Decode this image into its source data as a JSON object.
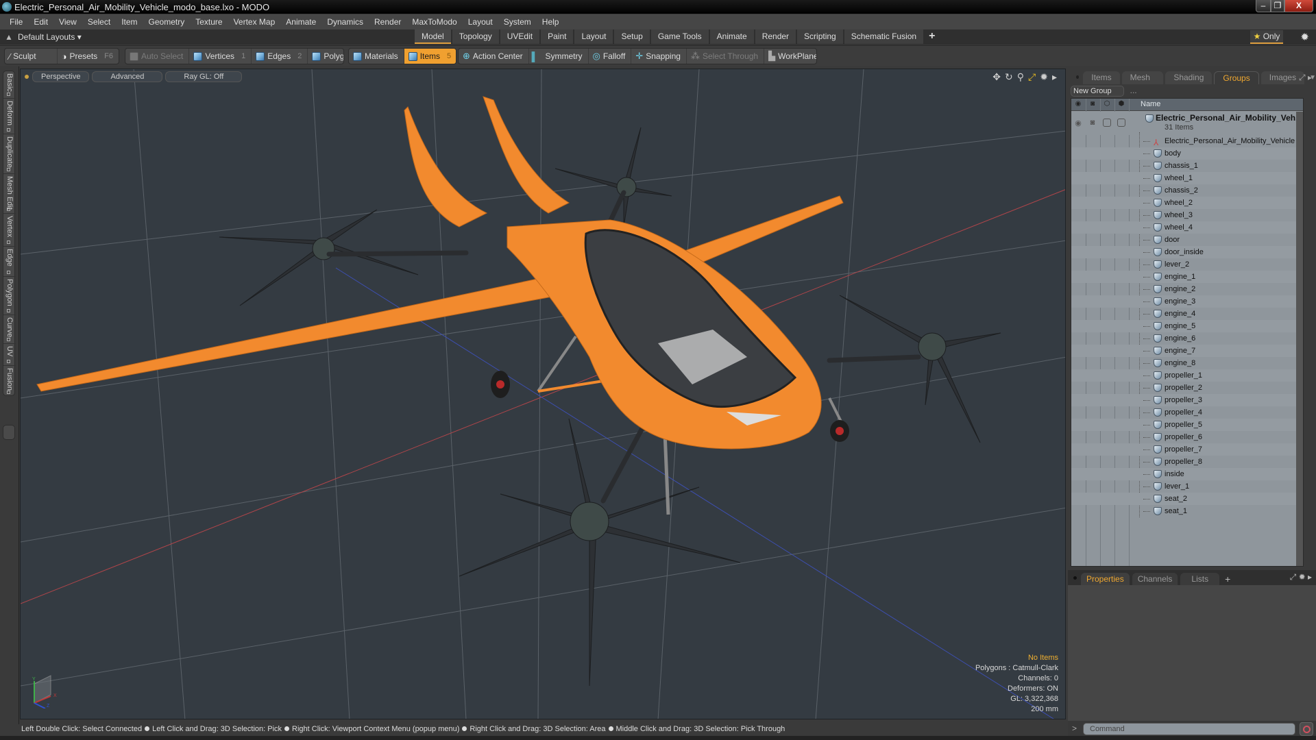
{
  "window": {
    "title": "Electric_Personal_Air_Mobility_Vehicle_modo_base.lxo - MODO",
    "app_icon": "modo-logo-icon",
    "controls": [
      "minimize",
      "restore",
      "close"
    ]
  },
  "menubar": [
    "File",
    "Edit",
    "View",
    "Select",
    "Item",
    "Geometry",
    "Texture",
    "Vertex Map",
    "Animate",
    "Dynamics",
    "Render",
    "MaxToModo",
    "Layout",
    "System",
    "Help"
  ],
  "layoutbar": {
    "layouts_label": "Default Layouts",
    "tabs": [
      "Model",
      "Topology",
      "UVEdit",
      "Paint",
      "Layout",
      "Setup",
      "Game Tools",
      "Animate",
      "Render",
      "Scripting",
      "Schematic Fusion"
    ],
    "active_tab": "Model",
    "only_label": "Only"
  },
  "toolbar": {
    "sculpt": "Sculpt",
    "presets": "Presets",
    "presets_key": "F6",
    "auto_select": "Auto Select",
    "vertices": "Vertices",
    "vertices_key": "1",
    "edges": "Edges",
    "edges_key": "2",
    "polygons": "Polygons",
    "materials": "Materials",
    "items": "Items",
    "items_key": "5",
    "action_center": "Action Center",
    "symmetry": "Symmetry",
    "falloff": "Falloff",
    "snapping": "Snapping",
    "select_through": "Select Through",
    "workplane": "WorkPlane"
  },
  "left_tabs": [
    "Basic",
    "Deform",
    "Duplicate",
    "Mesh Edit",
    "Vertex",
    "Edge",
    "Polygon",
    "Curve",
    "UV",
    "Fusion"
  ],
  "viewport": {
    "view_mode": "Perspective",
    "shading": "Advanced",
    "raygl": "Ray GL: Off",
    "info": {
      "selection": "No Items",
      "polygons": "Polygons : Catmull-Clark",
      "channels": "Channels: 0",
      "deformers": "Deformers: ON",
      "gl": "GL: 3,322,368",
      "scale": "200 mm"
    },
    "gizmo_axes": [
      "Y",
      "X",
      "Z"
    ],
    "model_color": "#f28a2e"
  },
  "statusbar": [
    "Left Double Click: Select Connected",
    "Left Click and Drag: 3D Selection: Pick",
    "Right Click: Viewport Context Menu (popup menu)",
    "Right Click and Drag: 3D Selection: Area",
    "Middle Click and Drag: 3D Selection: Pick Through"
  ],
  "right_panel": {
    "tabs": [
      "Items",
      "Mesh ...",
      "Shading",
      "Groups",
      "Images"
    ],
    "active_tab": "Groups",
    "new_group": "New Group",
    "column_name": "Name",
    "root": {
      "name": "Electric_Personal_Air_Mobility_Veh...",
      "count": "31 Items"
    },
    "items": [
      {
        "name": "Electric_Personal_Air_Mobility_Vehicle",
        "type": "locator"
      },
      {
        "name": "body",
        "type": "mesh"
      },
      {
        "name": "chassis_1",
        "type": "mesh"
      },
      {
        "name": "wheel_1",
        "type": "mesh"
      },
      {
        "name": "chassis_2",
        "type": "mesh"
      },
      {
        "name": "wheel_2",
        "type": "mesh"
      },
      {
        "name": "wheel_3",
        "type": "mesh"
      },
      {
        "name": "wheel_4",
        "type": "mesh"
      },
      {
        "name": "door",
        "type": "mesh"
      },
      {
        "name": "door_inside",
        "type": "mesh"
      },
      {
        "name": "lever_2",
        "type": "mesh"
      },
      {
        "name": "engine_1",
        "type": "mesh"
      },
      {
        "name": "engine_2",
        "type": "mesh"
      },
      {
        "name": "engine_3",
        "type": "mesh"
      },
      {
        "name": "engine_4",
        "type": "mesh"
      },
      {
        "name": "engine_5",
        "type": "mesh"
      },
      {
        "name": "engine_6",
        "type": "mesh"
      },
      {
        "name": "engine_7",
        "type": "mesh"
      },
      {
        "name": "engine_8",
        "type": "mesh"
      },
      {
        "name": "propeller_1",
        "type": "mesh"
      },
      {
        "name": "propeller_2",
        "type": "mesh"
      },
      {
        "name": "propeller_3",
        "type": "mesh"
      },
      {
        "name": "propeller_4",
        "type": "mesh"
      },
      {
        "name": "propeller_5",
        "type": "mesh"
      },
      {
        "name": "propeller_6",
        "type": "mesh"
      },
      {
        "name": "propeller_7",
        "type": "mesh"
      },
      {
        "name": "propeller_8",
        "type": "mesh"
      },
      {
        "name": "inside",
        "type": "mesh"
      },
      {
        "name": "lever_1",
        "type": "mesh"
      },
      {
        "name": "seat_2",
        "type": "mesh"
      },
      {
        "name": "seat_1",
        "type": "mesh"
      }
    ]
  },
  "properties_panel": {
    "tabs": [
      "Properties",
      "Channels",
      "Lists"
    ],
    "active_tab": "Properties"
  },
  "command": {
    "placeholder": "Command",
    "prompt": ">"
  }
}
